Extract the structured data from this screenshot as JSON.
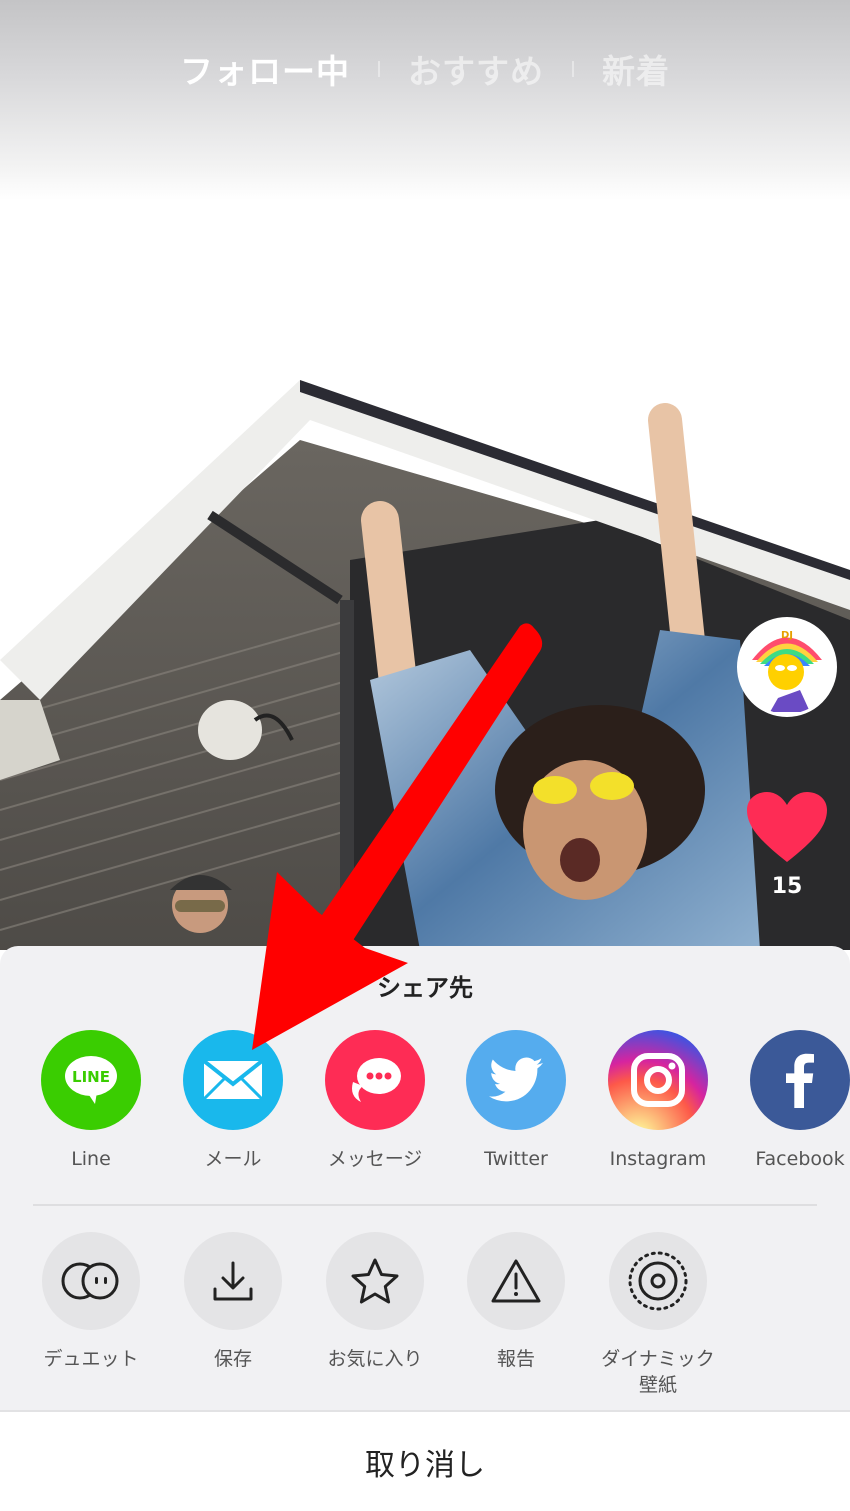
{
  "header": {
    "tabs": [
      {
        "label": "フォロー中",
        "active": true
      },
      {
        "label": "おすすめ",
        "active": false
      },
      {
        "label": "新着",
        "active": false
      }
    ]
  },
  "right_rail": {
    "like_count": "15",
    "like_color": "#fe2c55"
  },
  "share_sheet": {
    "title": "シェア先",
    "share_targets": [
      {
        "label": "Line",
        "icon": "line-icon",
        "color": "#3acd01"
      },
      {
        "label": "メール",
        "icon": "mail-icon",
        "color": "#19b8ec"
      },
      {
        "label": "メッセージ",
        "icon": "message-icon",
        "color": "#fe2c55"
      },
      {
        "label": "Twitter",
        "icon": "twitter-icon",
        "color": "#55acee"
      },
      {
        "label": "Instagram",
        "icon": "instagram-icon",
        "color": "#c13584"
      },
      {
        "label": "Facebook",
        "icon": "facebook-icon",
        "color": "#3b5998"
      }
    ],
    "actions": [
      {
        "label": "デュエット",
        "icon": "duet-icon"
      },
      {
        "label": "保存",
        "icon": "download-icon"
      },
      {
        "label": "お気に入り",
        "icon": "star-icon"
      },
      {
        "label": "報告",
        "icon": "warning-icon"
      },
      {
        "label": "ダイナミック\n壁紙",
        "label_line1": "ダイナミック",
        "label_line2": "壁紙",
        "icon": "live-wallpaper-icon"
      }
    ],
    "cancel_label": "取り消し"
  },
  "annotation": {
    "type": "arrow",
    "color": "#ff0000",
    "points_to": "メール"
  }
}
